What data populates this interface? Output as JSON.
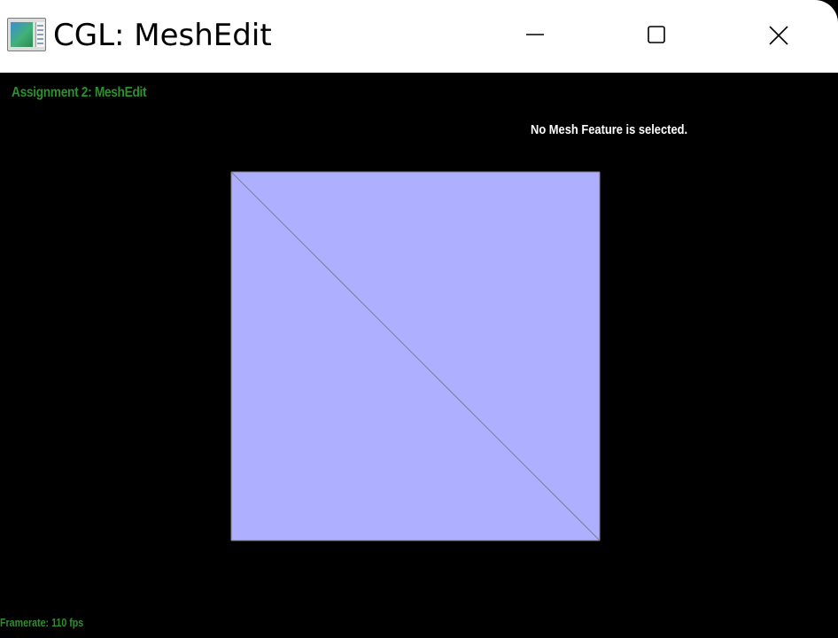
{
  "window": {
    "title": "CGL: MeshEdit",
    "icon": "app-window-icon",
    "controls": {
      "minimize_icon": "minimize-icon",
      "maximize_icon": "maximize-icon",
      "close_icon": "close-icon"
    }
  },
  "hud": {
    "title": "Assignment 2: MeshEdit",
    "status": "No Mesh Feature is selected.",
    "framerate": "Framerate: 110 fps"
  },
  "colors": {
    "background": "#000000",
    "titlebar": "#ffffff",
    "hud_green": "#2f8f2f",
    "status_text": "#ffffff",
    "mesh_face": "#aeaffe",
    "mesh_edge": "#808080"
  },
  "mesh": {
    "faces": 2,
    "shape": "square split by one diagonal"
  }
}
